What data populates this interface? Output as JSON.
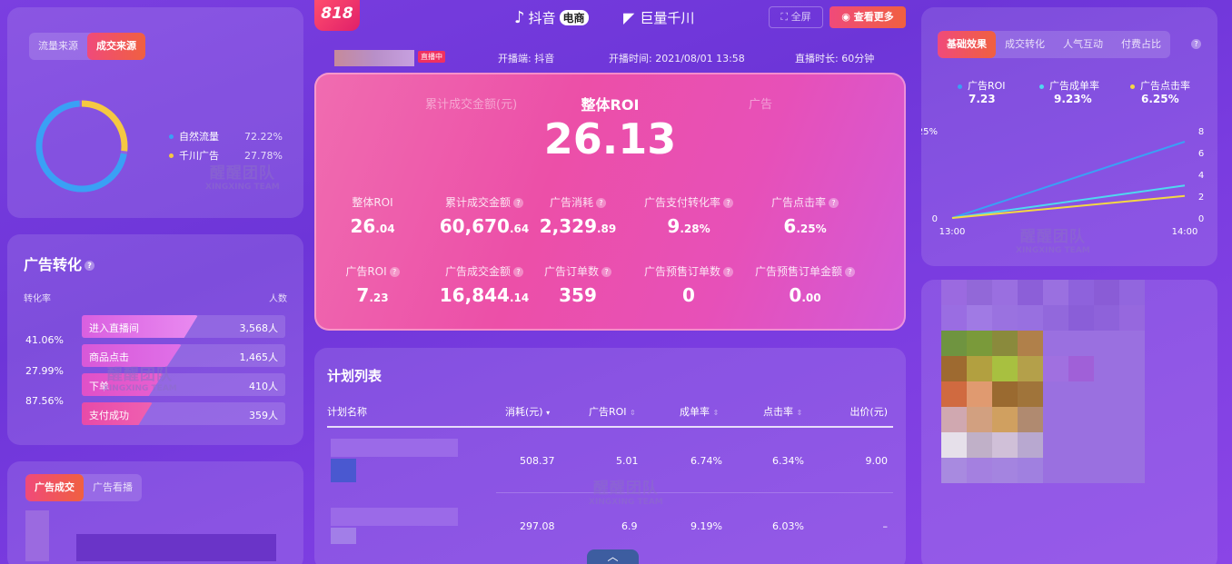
{
  "header": {
    "logo_818": "818",
    "brand1": "抖音",
    "brand1_tag": "电商",
    "brand2": "巨量千川",
    "fullscreen": "全屏",
    "see_more": "查看更多",
    "live_badge": "直播中",
    "platform": "开播端: 抖音",
    "start_time": "开播时间: 2021/08/01 13:58",
    "duration": "直播时长: 60分钟"
  },
  "source_panel": {
    "tabs": [
      "流量来源",
      "成交来源"
    ],
    "active_tab": 1,
    "legend": [
      {
        "name": "自然流量",
        "value": "72.22%",
        "color": "#3aa0f5"
      },
      {
        "name": "千川广告",
        "value": "27.78%",
        "color": "#f5c842"
      }
    ],
    "donut": [
      72.22,
      27.78
    ]
  },
  "watermark": {
    "big": "醒醒团队",
    "small": "XINGXING TEAM"
  },
  "funnel_panel": {
    "title": "广告转化",
    "col_left": "转化率",
    "col_right": "人数",
    "rates": [
      "41.06%",
      "27.99%",
      "87.56%"
    ],
    "steps": [
      {
        "name": "进入直播间",
        "count": "3,568人"
      },
      {
        "name": "商品点击",
        "count": "1,465人"
      },
      {
        "name": "下单",
        "count": "410人"
      },
      {
        "name": "支付成功",
        "count": "359人"
      }
    ]
  },
  "ad_panel": {
    "tabs": [
      "广告成交",
      "广告看播"
    ],
    "active_tab": 0
  },
  "hero": {
    "side_left": "累计成交金额(元)",
    "title": "整体ROI",
    "side_right": "广告",
    "big_value": "26.13",
    "metrics": [
      {
        "label": "整体ROI",
        "int": "26",
        "dec": ".04",
        "help": false
      },
      {
        "label": "累计成交金额",
        "int": "60,670",
        "dec": ".64",
        "help": true
      },
      {
        "label": "广告消耗",
        "int": "2,329",
        "dec": ".89",
        "help": true
      },
      {
        "label": "广告支付转化率",
        "int": "9",
        "dec": ".28%",
        "help": true
      },
      {
        "label": "广告点击率",
        "int": "6",
        "dec": ".25%",
        "help": true
      },
      {
        "label": "广告ROI",
        "int": "7",
        "dec": ".23",
        "help": true
      },
      {
        "label": "广告成交金额",
        "int": "16,844",
        "dec": ".14",
        "help": true
      },
      {
        "label": "广告订单数",
        "int": "359",
        "dec": "",
        "help": true
      },
      {
        "label": "广告预售订单数",
        "int": "0",
        "dec": "",
        "help": true
      },
      {
        "label": "广告预售订单金额",
        "int": "0",
        "dec": ".00",
        "help": true
      }
    ]
  },
  "plan_table": {
    "title": "计划列表",
    "columns": [
      "计划名称",
      "消耗(元)",
      "广告ROI",
      "成单率",
      "点击率",
      "出价(元)"
    ],
    "rows": [
      [
        "",
        "508.37",
        "5.01",
        "6.74%",
        "6.34%",
        "9.00"
      ],
      [
        "",
        "297.08",
        "6.9",
        "9.19%",
        "6.03%",
        "–"
      ]
    ],
    "collapse_icon": "chevron-up-icon"
  },
  "effect_panel": {
    "tabs": [
      "基础效果",
      "成交转化",
      "人气互动",
      "付费占比"
    ],
    "active_tab": 0,
    "legend": [
      {
        "name": "广告ROI",
        "value": "7.23",
        "color": "#3aa0f5"
      },
      {
        "name": "广告成单率",
        "value": "9.23%",
        "color": "#4fd8f0"
      },
      {
        "name": "广告点击率",
        "value": "6.25%",
        "color": "#f5d842"
      }
    ]
  },
  "chart_data": {
    "type": "line",
    "x": [
      "13:00",
      "14:00"
    ],
    "y_left_ticks": [
      "0",
      "25%"
    ],
    "y_right_ticks": [
      "0",
      "2",
      "4",
      "6",
      "8"
    ],
    "ylim_left": [
      0,
      25
    ],
    "ylim_right": [
      0,
      8
    ],
    "series": [
      {
        "name": "广告ROI",
        "values": [
          0,
          7.0
        ],
        "axis": "right",
        "color": "#3aa0f5"
      },
      {
        "name": "广告成单率",
        "values": [
          0,
          9.3
        ],
        "axis": "left",
        "color": "#4fd8f0"
      },
      {
        "name": "广告点击率",
        "values": [
          0,
          6.3
        ],
        "axis": "left",
        "color": "#f5d842"
      }
    ]
  }
}
